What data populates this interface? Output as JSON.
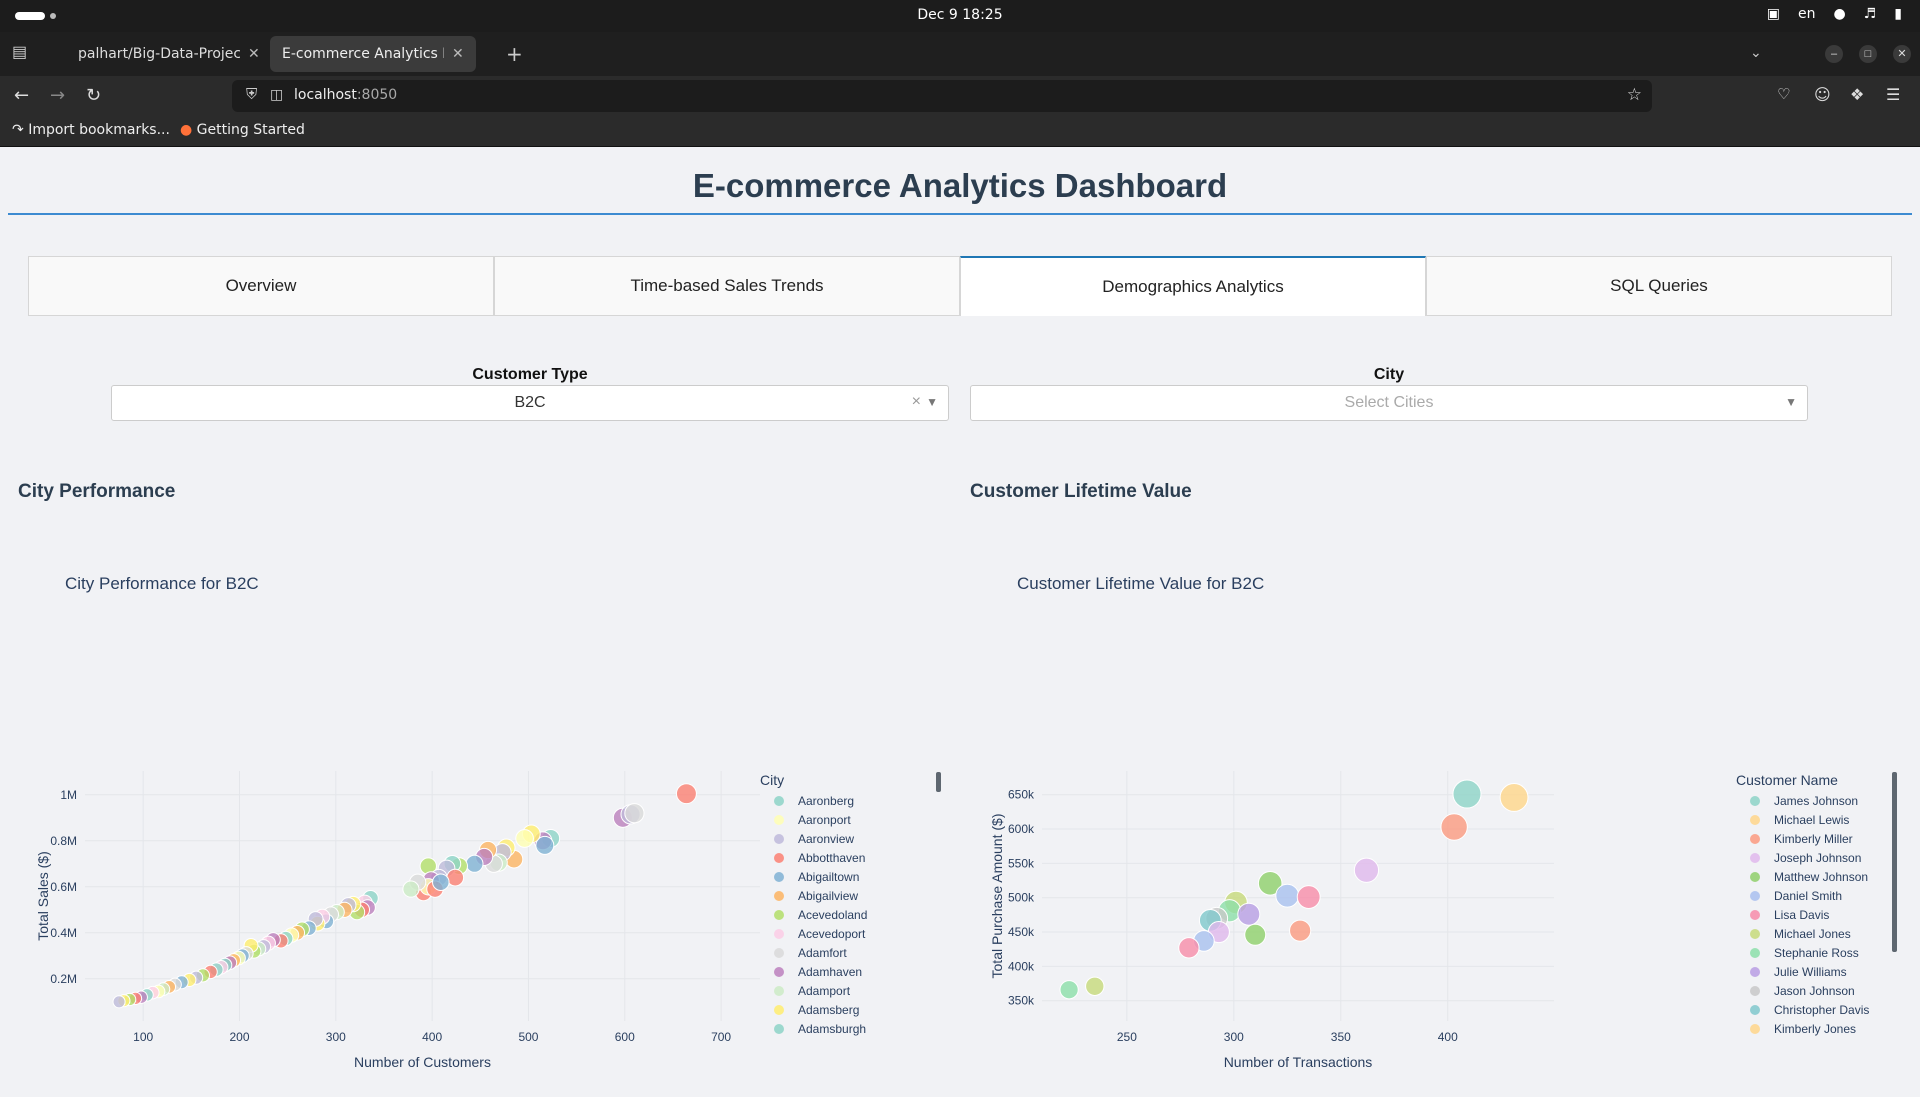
{
  "os": {
    "clock": "Dec 9  18:25",
    "lang": "en"
  },
  "browser": {
    "tabs": [
      {
        "label": "palhart/Big-Data-Project"
      },
      {
        "label": "E-commerce Analytics Dashboard"
      }
    ],
    "new_tab_symbol": "+",
    "url_host": "localhost",
    "url_port": ":8050",
    "bookmarks": [
      {
        "label": "Import bookmarks..."
      },
      {
        "label": "Getting Started"
      }
    ]
  },
  "page": {
    "title": "E-commerce Analytics Dashboard",
    "tabs": [
      {
        "label": "Overview",
        "selected": false
      },
      {
        "label": "Time-based Sales Trends",
        "selected": false
      },
      {
        "label": "Demographics Analytics",
        "selected": true
      },
      {
        "label": "SQL Queries",
        "selected": false
      }
    ],
    "filters": {
      "customer_type": {
        "label": "Customer Type",
        "value": "B2C"
      },
      "city": {
        "label": "City",
        "placeholder": "Select Cities"
      }
    },
    "sections": {
      "city": "City Performance",
      "clv": "Customer Lifetime Value"
    }
  },
  "chart_data": [
    {
      "type": "scatter",
      "title": "City Performance for B2C",
      "xlabel": "Number of Customers",
      "ylabel": "Total Sales ($)",
      "x_ticks": [
        "100",
        "200",
        "300",
        "400",
        "500",
        "600",
        "700"
      ],
      "y_ticks": [
        "0.2M",
        "0.4M",
        "0.6M",
        "0.8M",
        "1M"
      ],
      "xlim": [
        50,
        730
      ],
      "ylim": [
        60000,
        1060000
      ],
      "legend_title": "City",
      "legend": [
        "Aaronberg",
        "Aaronport",
        "Aaronview",
        "Abbotthaven",
        "Abigailtown",
        "Abigailview",
        "Acevedoland",
        "Acevedoport",
        "Adamfort",
        "Adamhaven",
        "Adamport",
        "Adamsberg",
        "Adamsburgh"
      ],
      "colors": [
        "#8dd3c7",
        "#ffffb3",
        "#bebada",
        "#fb8072",
        "#80b1d3",
        "#fdb462",
        "#b3de69",
        "#fccde5",
        "#d9d9d9",
        "#bc80bd",
        "#ccebc5",
        "#ffed6f",
        "#8dd3c7"
      ],
      "points": [
        [
          664,
          1005000,
          3
        ],
        [
          598,
          900000,
          9
        ],
        [
          606,
          915000,
          2
        ],
        [
          610,
          920000,
          8
        ],
        [
          523,
          810000,
          0
        ],
        [
          515,
          800000,
          9
        ],
        [
          517,
          780000,
          4
        ],
        [
          503,
          830000,
          11
        ],
        [
          496,
          810000,
          1
        ],
        [
          485,
          720000,
          5
        ],
        [
          477,
          770000,
          11
        ],
        [
          473,
          750000,
          2
        ],
        [
          469,
          705000,
          10
        ],
        [
          464,
          700000,
          8
        ],
        [
          458,
          760000,
          5
        ],
        [
          454,
          730000,
          9
        ],
        [
          444,
          700000,
          4
        ],
        [
          428,
          690000,
          6
        ],
        [
          421,
          700000,
          0
        ],
        [
          415,
          680000,
          2
        ],
        [
          396,
          690000,
          6
        ],
        [
          407,
          640000,
          2
        ],
        [
          399,
          630000,
          9
        ],
        [
          424,
          640000,
          3
        ],
        [
          391,
          575000,
          3
        ],
        [
          396,
          600000,
          1
        ],
        [
          385,
          620000,
          8
        ],
        [
          378,
          590000,
          10
        ],
        [
          403,
          590000,
          3
        ],
        [
          409,
          620000,
          4
        ],
        [
          336,
          550000,
          0
        ],
        [
          330,
          530000,
          7
        ],
        [
          333,
          510000,
          9
        ],
        [
          327,
          500000,
          3
        ],
        [
          322,
          490000,
          6
        ],
        [
          318,
          525000,
          11
        ],
        [
          313,
          520000,
          2
        ],
        [
          309,
          500000,
          5
        ],
        [
          301,
          490000,
          10
        ],
        [
          295,
          480000,
          8
        ],
        [
          290,
          450000,
          4
        ],
        [
          286,
          470000,
          7
        ],
        [
          281,
          440000,
          11
        ],
        [
          279,
          460000,
          2
        ],
        [
          272,
          420000,
          4
        ],
        [
          265,
          415000,
          6
        ],
        [
          260,
          400000,
          5
        ],
        [
          254,
          390000,
          1
        ],
        [
          248,
          375000,
          0
        ],
        [
          243,
          365000,
          3
        ],
        [
          235,
          370000,
          9
        ],
        [
          230,
          355000,
          7
        ],
        [
          225,
          340000,
          2
        ],
        [
          220,
          330000,
          10
        ],
        [
          215,
          320000,
          6
        ],
        [
          212,
          345000,
          11
        ],
        [
          207,
          310000,
          8
        ],
        [
          203,
          300000,
          4
        ],
        [
          199,
          290000,
          1
        ],
        [
          194,
          280000,
          5
        ],
        [
          190,
          270000,
          9
        ],
        [
          185,
          260000,
          0
        ],
        [
          181,
          250000,
          7
        ],
        [
          176,
          240000,
          12
        ],
        [
          170,
          230000,
          3
        ],
        [
          162,
          215000,
          6
        ],
        [
          155,
          205000,
          2
        ],
        [
          148,
          195000,
          11
        ],
        [
          140,
          185000,
          4
        ],
        [
          133,
          175000,
          8
        ],
        [
          127,
          165000,
          5
        ],
        [
          121,
          155000,
          10
        ],
        [
          116,
          145000,
          1
        ],
        [
          110,
          140000,
          7
        ],
        [
          104,
          130000,
          0
        ],
        [
          98,
          120000,
          9
        ],
        [
          92,
          115000,
          3
        ],
        [
          86,
          110000,
          6
        ],
        [
          80,
          105000,
          11
        ],
        [
          75,
          100000,
          2
        ]
      ]
    },
    {
      "type": "scatter",
      "title": "Customer Lifetime Value for B2C",
      "xlabel": "Number of Transactions",
      "ylabel": "Total Purchase Amount ($)",
      "x_ticks": [
        "250",
        "300",
        "350",
        "400"
      ],
      "y_ticks": [
        "350k",
        "400k",
        "450k",
        "500k",
        "550k",
        "600k",
        "650k"
      ],
      "xlim": [
        215,
        445
      ],
      "ylim": [
        335000,
        670000
      ],
      "legend_title": "Customer Name",
      "legend": [
        "James Johnson",
        "Michael Lewis",
        "Kimberly Miller",
        "Joseph Johnson",
        "Matthew Johnson",
        "Daniel Smith",
        "Lisa Davis",
        "Michael Jones",
        "Stephanie Ross",
        "Julie Williams",
        "Jason Johnson",
        "Christopher Davis",
        "Kimberly Jones"
      ],
      "colors": [
        "#8dd3c7",
        "#ffd68a",
        "#fb9a7f",
        "#e0b8ec",
        "#8fcf6a",
        "#a9c0ef",
        "#f78ca9",
        "#c7da7a",
        "#8cdfa9",
        "#b89ee3",
        "#c8c8c8",
        "#80c8cc",
        "#ffd68a"
      ],
      "points": [
        [
          409,
          651000,
          0
        ],
        [
          431,
          646000,
          1
        ],
        [
          403,
          603000,
          2
        ],
        [
          362,
          540000,
          3
        ],
        [
          317,
          521000,
          4
        ],
        [
          325,
          503000,
          5
        ],
        [
          335,
          501000,
          6
        ],
        [
          301,
          493000,
          7
        ],
        [
          298,
          481000,
          8
        ],
        [
          307,
          476000,
          9
        ],
        [
          292,
          470000,
          10
        ],
        [
          289,
          467000,
          11
        ],
        [
          293,
          450000,
          3
        ],
        [
          310,
          446000,
          4
        ],
        [
          331,
          452000,
          2
        ],
        [
          286,
          437000,
          5
        ],
        [
          279,
          427000,
          6
        ],
        [
          223,
          366000,
          8
        ],
        [
          235,
          371000,
          7
        ]
      ]
    }
  ]
}
